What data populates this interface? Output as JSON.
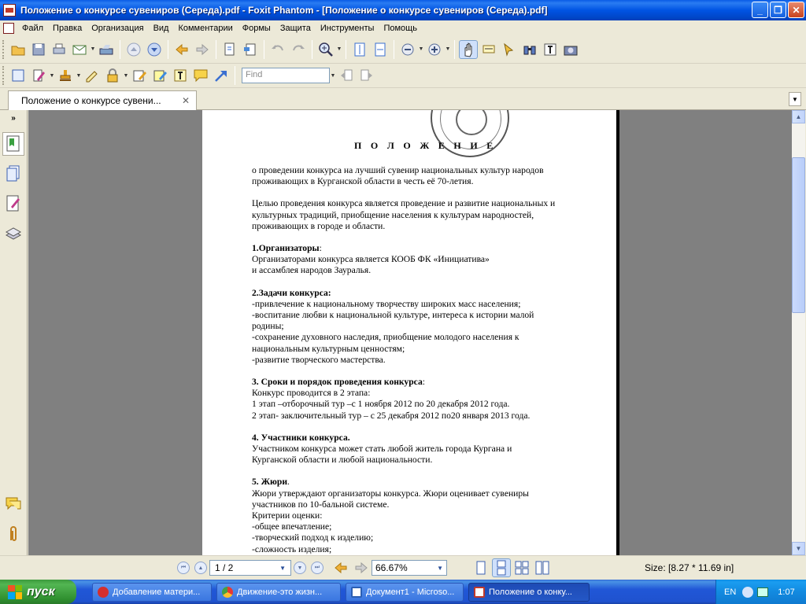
{
  "window": {
    "title": "Положение о конкурсе  сувениров (Середа).pdf - Foxit Phantom - [Положение о конкурсе  сувениров (Середа).pdf]",
    "minimize": "_",
    "maximize": "❐",
    "close": "✕"
  },
  "menu": [
    "Файл",
    "Правка",
    "Организация",
    "Вид",
    "Комментарии",
    "Формы",
    "Защита",
    "Инструменты",
    "Помощь"
  ],
  "toolbar": {
    "find_placeholder": "Find"
  },
  "tab": {
    "label": "Положение о конкурсе  сувени...",
    "close": "✕"
  },
  "document": {
    "title": "П О Л О Ж Е Н И Е",
    "lines": [
      {
        "text": "о проведении конкурса на лучший сувенир национальных культур народов",
        "bold": false
      },
      {
        "text": "проживающих в Курганской области в честь её 70-летия.",
        "bold": false
      },
      {
        "text": "",
        "gap": true
      },
      {
        "text": "Целью проведения конкурса является проведение и развитие национальных и",
        "bold": false
      },
      {
        "text": "культурных традиций, приобщение населения к культурам народностей,",
        "bold": false
      },
      {
        "text": "проживающих в городе и области.",
        "bold": false
      },
      {
        "text": "",
        "gap": true
      },
      {
        "text": "1.Организаторы",
        "bold": true,
        "suffix": ":"
      },
      {
        "text": "Организаторами конкурса является КООБ ФК «Инициатива»",
        "bold": false
      },
      {
        "text": "и ассамблея народов Зауралья.",
        "bold": false
      },
      {
        "text": "",
        "gap": true
      },
      {
        "text": "2.Задачи конкурса:",
        "bold": true
      },
      {
        "text": "-привлечение к национальному творчеству широких масс населения;",
        "bold": false
      },
      {
        "text": "-воспитание любви к национальной культуре, интереса к истории малой",
        "bold": false
      },
      {
        "text": "родины;",
        "bold": false
      },
      {
        "text": "-сохранение духовного наследия, приобщение молодого населения к",
        "bold": false
      },
      {
        "text": "национальным культурным ценностям;",
        "bold": false
      },
      {
        "text": "-развитие творческого мастерства.",
        "bold": false
      },
      {
        "text": "",
        "gap": true
      },
      {
        "text": "3. Сроки и порядок проведения конкурса",
        "bold": true,
        "suffix": ":"
      },
      {
        "text": "Конкурс проводится в 2 этапа:",
        "bold": false
      },
      {
        "text": "1 этап –отборочный тур –с 1 ноября 2012 по 20 декабря 2012 года.",
        "bold": false
      },
      {
        "text": "2 этап- заключительный тур – с 25 декабря 2012 по20 января 2013 года.",
        "bold": false
      },
      {
        "text": "",
        "gap": true
      },
      {
        "text": "4. Участники конкурса.",
        "bold": true
      },
      {
        "text": "Участником конкурса может стать любой житель города Кургана и",
        "bold": false
      },
      {
        "text": "Курганской области и любой национальности.",
        "bold": false
      },
      {
        "text": "",
        "gap": true
      },
      {
        "text": "5. Жюри",
        "bold": true,
        "suffix": "."
      },
      {
        "text": "Жюри утверждают организаторы конкурса. Жюри оценивает сувениры",
        "bold": false
      },
      {
        "text": "участников по 10-бальной системе.",
        "bold": false
      },
      {
        "text": "Критерии оценки:",
        "bold": false
      },
      {
        "text": "-общее впечатление;",
        "bold": false
      },
      {
        "text": "-творческий подход к изделию;",
        "bold": false
      },
      {
        "text": "-сложность изделия;",
        "bold": false
      }
    ]
  },
  "statusbar": {
    "page": "1 / 2",
    "zoom": "66.67%",
    "size": "Size: [8.27 * 11.69 in]"
  },
  "taskbar": {
    "start": "пуск",
    "tasks": [
      {
        "label": "Добавление матери...",
        "color": "#d32f2f",
        "active": false
      },
      {
        "label": "Движение-это жизн...",
        "color": "#e8a020",
        "active": false
      },
      {
        "label": "Документ1 - Microso...",
        "color": "#2b5fb4",
        "active": false
      },
      {
        "label": "Положение о конку...",
        "color": "#c0392b",
        "active": true
      }
    ],
    "lang": "EN",
    "clock": "1:07"
  }
}
